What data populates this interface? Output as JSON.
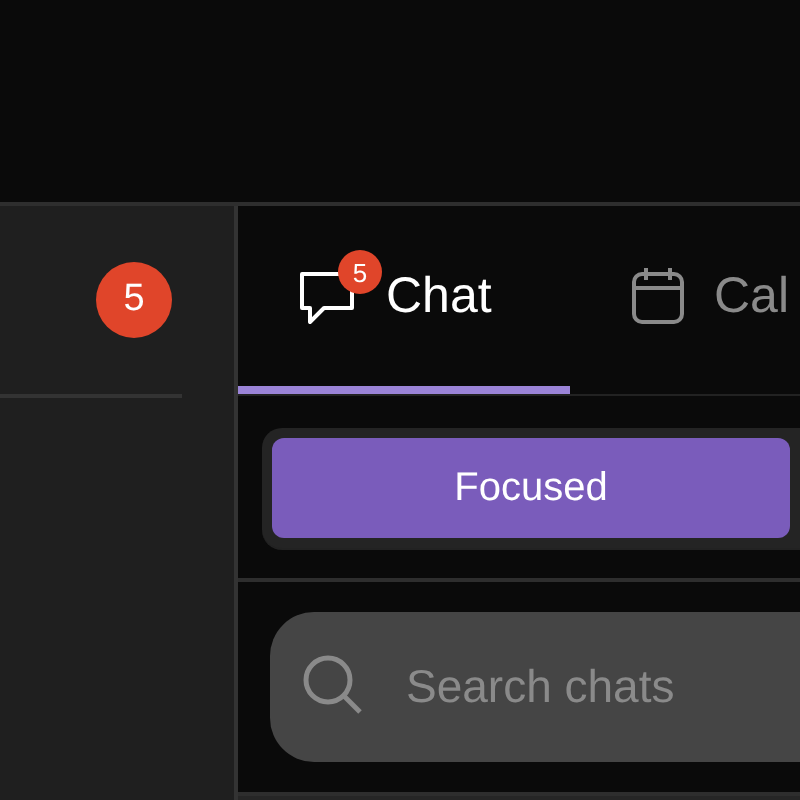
{
  "sidebar": {
    "badge": "5"
  },
  "tabs": [
    {
      "label": "Chat",
      "badge": "5",
      "kind": "chat",
      "selected": true
    },
    {
      "label": "Cal",
      "kind": "calendar",
      "selected": false
    }
  ],
  "filter": {
    "label": "Focused",
    "selected": true
  },
  "search": {
    "placeholder": "Search chats"
  }
}
